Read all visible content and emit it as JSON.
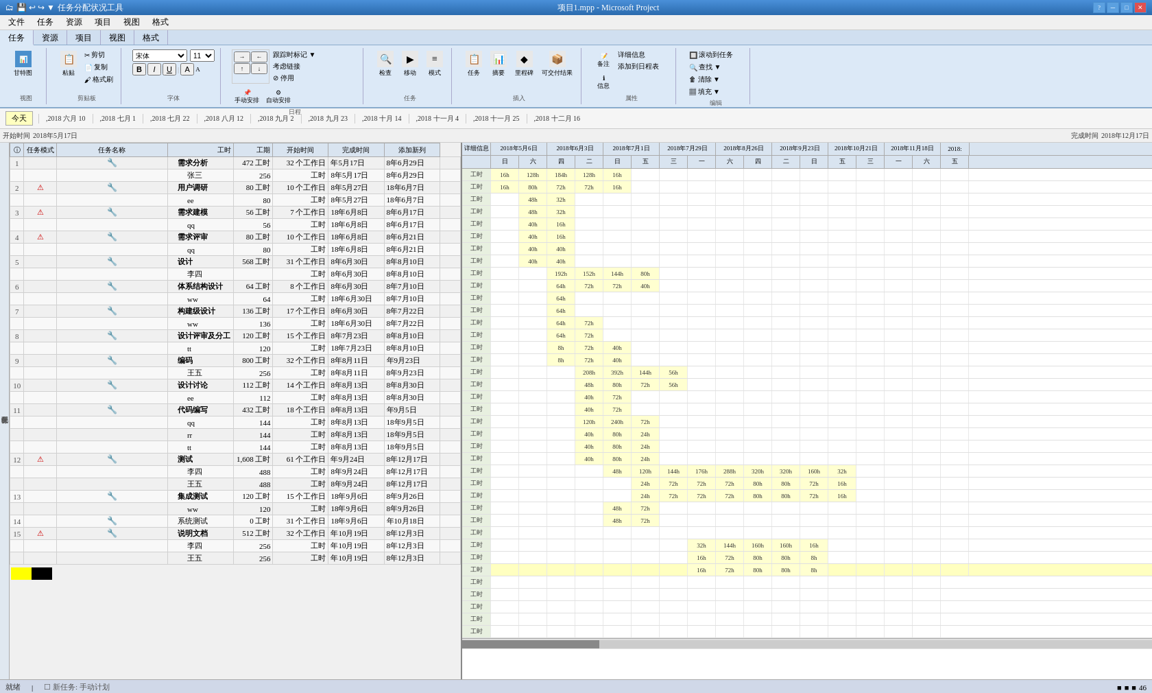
{
  "titleBar": {
    "leftTool": "任务分配状况工具",
    "title": "项目1.mpp - Microsoft Project",
    "minimize": "─",
    "maximize": "□",
    "close": "✕"
  },
  "menuBar": {
    "items": [
      "文件",
      "任务",
      "资源",
      "项目",
      "视图",
      "格式"
    ]
  },
  "ribbon": {
    "tabs": [
      "文件",
      "任务",
      "资源",
      "项目",
      "视图",
      "格式"
    ],
    "activeTab": "任务"
  },
  "timeline": {
    "todayLabel": "今天",
    "labels": [
      ",2018 六月 10",
      ",2018 七月 1",
      ",2018 七月 22",
      ",2018 八月 12",
      ",2018 九月 2",
      ",2018 九月 23",
      ",2018 十月 14",
      ",2018 十一月 4",
      ",2018 十一月 25",
      ",2018 十二月 16"
    ]
  },
  "projectTime": {
    "startLabel": "开始时间",
    "startValue": "2018年5月17日",
    "endLabel": "完成时间",
    "endValue": "2018年12月17日"
  },
  "tableHeaders": {
    "id": "",
    "info": "ⓘ",
    "mode": "任务模式",
    "name": "任务名称",
    "work": "工时",
    "duration": "工期",
    "start": "开始时间",
    "finish": "完成时间",
    "addCol": "添加新列"
  },
  "tasks": [
    {
      "id": 1,
      "level": 1,
      "name": "需求分析",
      "work": "472 工时",
      "duration": "32 个工作日",
      "start": "年5月17日",
      "finish": "8年6月29日",
      "indent": 0,
      "bold": true,
      "hasWarning": false
    },
    {
      "id": "",
      "level": 2,
      "name": "张三",
      "work": "256",
      "duration": "工时",
      "start": "8年5月17日",
      "finish": "8年6月29日",
      "indent": 1,
      "bold": false,
      "hasWarning": false
    },
    {
      "id": 2,
      "level": 1,
      "name": "用户调研",
      "work": "80 工时",
      "duration": "10 个工作日",
      "start": "8年5月27日",
      "finish": "18年6月7日",
      "indent": 0,
      "bold": true,
      "hasWarning": true
    },
    {
      "id": "",
      "level": 2,
      "name": "ee",
      "work": "80",
      "duration": "工时",
      "start": "8年5月27日",
      "finish": "18年6月7日",
      "indent": 1,
      "bold": false,
      "hasWarning": false
    },
    {
      "id": 3,
      "level": 1,
      "name": "需求建模",
      "work": "56 工时",
      "duration": "7 个工作日",
      "start": "18年6月8日",
      "finish": "8年6月17日",
      "indent": 0,
      "bold": true,
      "hasWarning": true
    },
    {
      "id": "",
      "level": 2,
      "name": "qq",
      "work": "56",
      "duration": "工时",
      "start": "18年6月8日",
      "finish": "8年6月17日",
      "indent": 1,
      "bold": false,
      "hasWarning": false
    },
    {
      "id": 4,
      "level": 1,
      "name": "需求评审",
      "work": "80 工时",
      "duration": "10 个工作日",
      "start": "18年6月8日",
      "finish": "8年6月21日",
      "indent": 0,
      "bold": true,
      "hasWarning": true
    },
    {
      "id": "",
      "level": 2,
      "name": "qq",
      "work": "80",
      "duration": "工时",
      "start": "18年6月8日",
      "finish": "8年6月21日",
      "indent": 1,
      "bold": false,
      "hasWarning": false
    },
    {
      "id": 5,
      "level": 1,
      "name": "设计",
      "work": "568 工时",
      "duration": "31 个工作日",
      "start": "8年6月30日",
      "finish": "8年8月10日",
      "indent": 0,
      "bold": true,
      "hasWarning": false
    },
    {
      "id": "",
      "level": 2,
      "name": "李四",
      "work": "",
      "duration": "工时",
      "start": "8年6月30日",
      "finish": "8年8月10日",
      "indent": 1,
      "bold": false,
      "hasWarning": false
    },
    {
      "id": 6,
      "level": 1,
      "name": "体系结构设计",
      "work": "64 工时",
      "duration": "8 个工作日",
      "start": "8年6月30日",
      "finish": "8年7月10日",
      "indent": 0,
      "bold": true,
      "hasWarning": false
    },
    {
      "id": "",
      "level": 2,
      "name": "ww",
      "work": "64",
      "duration": "工时",
      "start": "18年6月30日",
      "finish": "8年7月10日",
      "indent": 1,
      "bold": false,
      "hasWarning": false
    },
    {
      "id": 7,
      "level": 1,
      "name": "构建级设计",
      "work": "136 工时",
      "duration": "17 个工作日",
      "start": "8年6月30日",
      "finish": "8年7月22日",
      "indent": 0,
      "bold": true,
      "hasWarning": false
    },
    {
      "id": "",
      "level": 2,
      "name": "ww",
      "work": "136",
      "duration": "工时",
      "start": "18年6月30日",
      "finish": "8年7月22日",
      "indent": 1,
      "bold": false,
      "hasWarning": false
    },
    {
      "id": 8,
      "level": 1,
      "name": "设计评审及分工",
      "work": "120 工时",
      "duration": "15 个工作日",
      "start": "8年7月23日",
      "finish": "8年8月10日",
      "indent": 0,
      "bold": true,
      "hasWarning": false
    },
    {
      "id": "",
      "level": 2,
      "name": "tt",
      "work": "120",
      "duration": "工时",
      "start": "18年7月23日",
      "finish": "8年8月10日",
      "indent": 1,
      "bold": false,
      "hasWarning": false
    },
    {
      "id": 9,
      "level": 1,
      "name": "编码",
      "work": "800 工时",
      "duration": "32 个工作日",
      "start": "8年8月11日",
      "finish": "年9月23日",
      "indent": 0,
      "bold": true,
      "hasWarning": false
    },
    {
      "id": "",
      "level": 2,
      "name": "王五",
      "work": "256",
      "duration": "工时",
      "start": "8年8月11日",
      "finish": "8年9月23日",
      "indent": 1,
      "bold": false,
      "hasWarning": false
    },
    {
      "id": 10,
      "level": 1,
      "name": "设计讨论",
      "work": "112 工时",
      "duration": "14 个工作日",
      "start": "8年8月13日",
      "finish": "8年8月30日",
      "indent": 0,
      "bold": true,
      "hasWarning": false
    },
    {
      "id": "",
      "level": 2,
      "name": "ee",
      "work": "112",
      "duration": "工时",
      "start": "8年8月13日",
      "finish": "8年8月30日",
      "indent": 1,
      "bold": false,
      "hasWarning": false
    },
    {
      "id": 11,
      "level": 1,
      "name": "代码编写",
      "work": "432 工时",
      "duration": "18 个工作日",
      "start": "8年8月13日",
      "finish": "年9月5日",
      "indent": 0,
      "bold": true,
      "hasWarning": false
    },
    {
      "id": "",
      "level": 2,
      "name": "qq",
      "work": "144",
      "duration": "工时",
      "start": "8年8月13日",
      "finish": "18年9月5日",
      "indent": 1,
      "bold": false,
      "hasWarning": false
    },
    {
      "id": "",
      "level": 2,
      "name": "rr",
      "work": "144",
      "duration": "工时",
      "start": "8年8月13日",
      "finish": "18年9月5日",
      "indent": 1,
      "bold": false,
      "hasWarning": false
    },
    {
      "id": "",
      "level": 2,
      "name": "tt",
      "work": "144",
      "duration": "工时",
      "start": "8年8月13日",
      "finish": "18年9月5日",
      "indent": 1,
      "bold": false,
      "hasWarning": false
    },
    {
      "id": 12,
      "level": 1,
      "name": "测试",
      "work": "1,608 工时",
      "duration": "61 个工作日",
      "start": "年9月24日",
      "finish": "8年12月17日",
      "indent": 0,
      "bold": true,
      "hasWarning": true
    },
    {
      "id": "",
      "level": 2,
      "name": "李四",
      "work": "488",
      "duration": "工时",
      "start": "8年9月24日",
      "finish": "8年12月17日",
      "indent": 1,
      "bold": false,
      "hasWarning": false
    },
    {
      "id": "",
      "level": 2,
      "name": "王五",
      "work": "488",
      "duration": "工时",
      "start": "8年9月24日",
      "finish": "8年12月17日",
      "indent": 1,
      "bold": false,
      "hasWarning": false
    },
    {
      "id": 13,
      "level": 1,
      "name": "集成测试",
      "work": "120 工时",
      "duration": "15 个工作日",
      "start": "18年9月6日",
      "finish": "8年9月26日",
      "indent": 0,
      "bold": true,
      "hasWarning": false
    },
    {
      "id": "",
      "level": 2,
      "name": "ww",
      "work": "120",
      "duration": "工时",
      "start": "18年9月6日",
      "finish": "8年9月26日",
      "indent": 1,
      "bold": false,
      "hasWarning": false
    },
    {
      "id": 14,
      "level": 1,
      "name": "系统测试",
      "work": "0 工时",
      "duration": "31 个工作日",
      "start": "18年9月6日",
      "finish": "年10月18日",
      "indent": 0,
      "bold": false,
      "hasWarning": false
    },
    {
      "id": 15,
      "level": 1,
      "name": "说明文档",
      "work": "512 工时",
      "duration": "32 个工作日",
      "start": "年10月19日",
      "finish": "8年12月3日",
      "indent": 0,
      "bold": true,
      "hasWarning": true
    },
    {
      "id": "",
      "level": 2,
      "name": "李四",
      "work": "256",
      "duration": "工时",
      "start": "年10月19日",
      "finish": "8年12月3日",
      "indent": 1,
      "bold": false,
      "hasWarning": false
    },
    {
      "id": "",
      "level": 2,
      "name": "王五",
      "work": "256",
      "duration": "工时",
      "start": "年10月19日",
      "finish": "8年12月3日",
      "indent": 1,
      "bold": false,
      "hasWarning": false
    }
  ],
  "ganttHeaders": {
    "row1": [
      {
        "label": "详细信息 2018年5月6日",
        "span": 2
      },
      {
        "label": "2018年6月3日",
        "span": 2
      },
      {
        "label": "2018年7月1日",
        "span": 2
      },
      {
        "label": "2018年7月29日",
        "span": 2
      },
      {
        "label": "2018年8月26日",
        "span": 2
      },
      {
        "label": "2018年9月23日",
        "span": 2
      },
      {
        "label": "2018年10月21日",
        "span": 2
      },
      {
        "label": "2018年11月18日",
        "span": 2
      },
      {
        "label": "2018:",
        "span": 1
      }
    ],
    "row2": [
      {
        "label": "日"
      },
      {
        "label": "六"
      },
      {
        "label": "四"
      },
      {
        "label": "二"
      },
      {
        "label": "日"
      },
      {
        "label": "五"
      },
      {
        "label": "三"
      },
      {
        "label": "一"
      },
      {
        "label": "六"
      },
      {
        "label": "四"
      },
      {
        "label": "二"
      },
      {
        "label": "日"
      },
      {
        "label": "五"
      },
      {
        "label": "三"
      },
      {
        "label": "一"
      },
      {
        "label": "六"
      },
      {
        "label": "五"
      }
    ]
  },
  "statusBar": {
    "ready": "就绪",
    "newTask": "新任务: 手动计划",
    "viewIcons": [
      "■",
      "■",
      "■",
      "46"
    ]
  }
}
